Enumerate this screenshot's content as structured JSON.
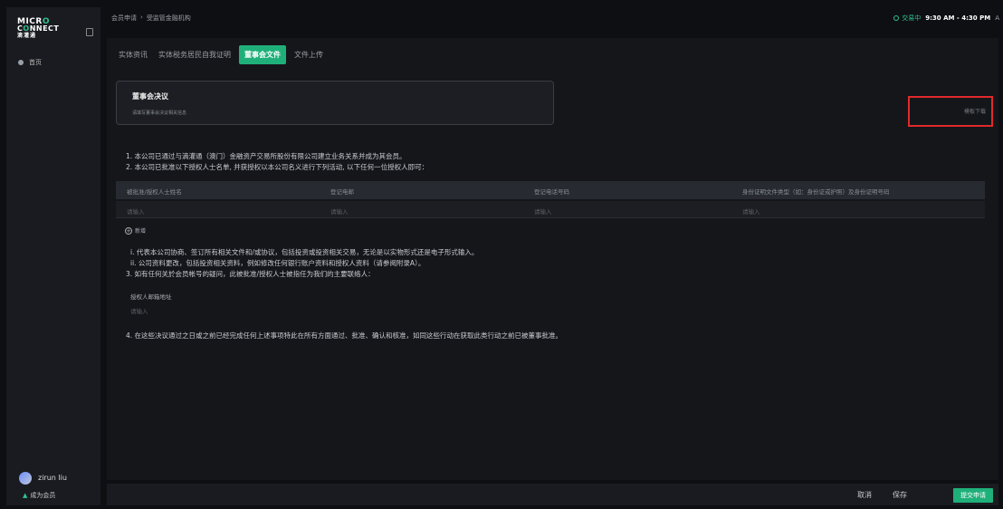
{
  "app": {
    "logo_line1": "MICR",
    "logo_line1_accent": "O",
    "logo_line2": "C",
    "logo_line2_accent": "O",
    "logo_line2_rest": "NNECT",
    "logo_line3": "滴灌通"
  },
  "sidebar": {
    "home_label": "首页",
    "user_name": "zirun liu",
    "member_link": "成为会员"
  },
  "topbar": {
    "breadcrumb": [
      "会员申请",
      "受监管金融机构"
    ],
    "status_label": "交易中",
    "hours": "9:30 AM - 4:30 PM",
    "lang": "A"
  },
  "tabs": [
    {
      "label": "实体资讯",
      "active": false
    },
    {
      "label": "实体税务居民自我证明",
      "active": false
    },
    {
      "label": "董事会文件",
      "active": true
    },
    {
      "label": "文件上传",
      "active": false
    }
  ],
  "resolution_card": {
    "title": "董事会决议",
    "subtitle": "请填写董事会决议相关信息"
  },
  "download_box": {
    "text": "模板下载"
  },
  "statements": {
    "s1": "1. 本公司已通过与滴灌通（澳门）金融资产交易所股份有限公司建立业务关系并成为其会员。",
    "s2": "2. 本公司已批准以下授权人士名单, 并获授权以本公司名义进行下列活动, 以下任何一位授权人即可：",
    "i": "i. 代表本公司协商、签订所有相关文件和/或协议，包括投资或投资相关交易，无论是以实物形式还是电子形式输入。",
    "ii": "ii. 公司资料更改，包括投资相关资料，例如修改任何银行账户资料和授权人资料（请参阅附录A）。",
    "s3": "3. 如有任何关於会员帐号的疑问，此被批准/授权人士被指任为我们的主要联络人：",
    "s4": "4. 在这些决议通过之日或之前已经完成任何上述事项特此在所有方面通过、批准、确认和核准，如同这些行动在获取此类行动之前已被董事批准。"
  },
  "authorized_table": {
    "columns": [
      "被批准/授权人士姓名",
      "登记电邮",
      "登记电话号码",
      "身份证明文件类型（如：身份证或护照）及身份证明号码"
    ],
    "placeholders": [
      "请输入",
      "请输入",
      "请输入",
      "请输入"
    ],
    "add_label": "新增"
  },
  "contact": {
    "email_label": "授权人邮箱地址",
    "email_placeholder": "请输入"
  },
  "footer": {
    "cancel": "取消",
    "save": "保存",
    "submit": "提交申请"
  }
}
